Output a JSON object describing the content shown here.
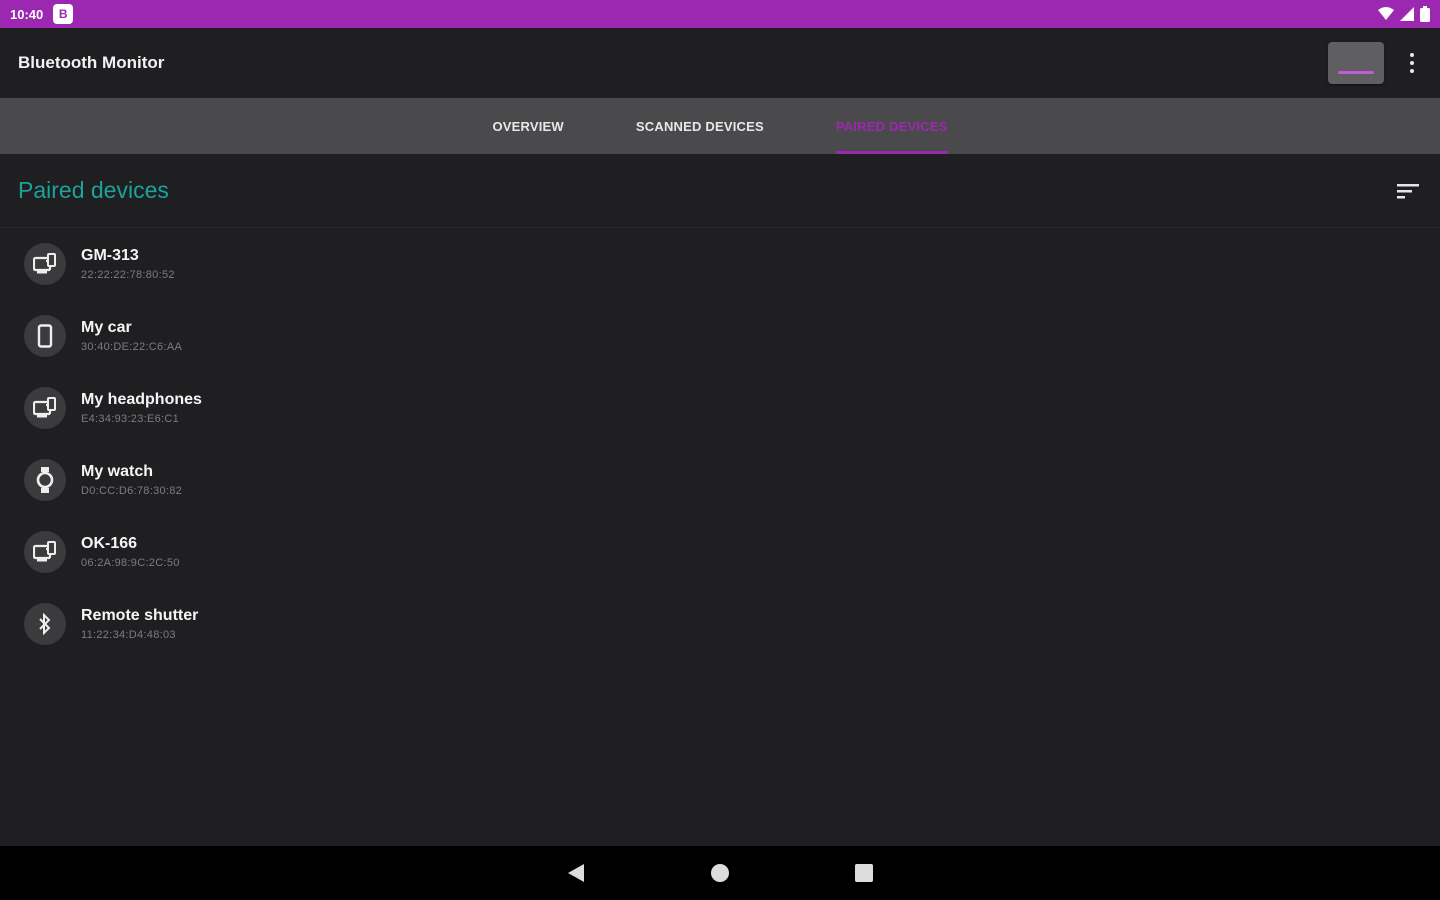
{
  "status_bar": {
    "time": "10:40",
    "notification_icon": "app-notification-icon",
    "notification_glyph": "B",
    "icons": [
      "wifi-icon",
      "cellular-signal-icon",
      "battery-icon"
    ]
  },
  "app_bar": {
    "title": "Bluetooth Monitor",
    "action_icon": "toggle-button-icon",
    "overflow_icon": "more-vert-icon"
  },
  "tabs": [
    {
      "label": "OVERVIEW",
      "active": false
    },
    {
      "label": "SCANNED DEVICES",
      "active": false
    },
    {
      "label": "PAIRED DEVICES",
      "active": true
    }
  ],
  "section": {
    "title": "Paired devices",
    "sort_icon": "sort-icon"
  },
  "devices": [
    {
      "name": "GM-313",
      "address": "22:22:22:78:80:52",
      "icon": "phonelink-icon"
    },
    {
      "name": "My car",
      "address": "30:40:DE:22:C6:AA",
      "icon": "phone-icon"
    },
    {
      "name": "My headphones",
      "address": "E4:34:93:23:E6:C1",
      "icon": "phonelink-icon"
    },
    {
      "name": "My watch",
      "address": "D0:CC:D6:78:30:82",
      "icon": "watch-icon"
    },
    {
      "name": "OK-166",
      "address": "06:2A:98:9C:2C:50",
      "icon": "phonelink-icon"
    },
    {
      "name": "Remote shutter",
      "address": "11:22:34:D4:48:03",
      "icon": "bluetooth-icon"
    }
  ],
  "nav_bar": {
    "icons": [
      "back-icon",
      "home-icon",
      "recents-icon"
    ]
  },
  "colors": {
    "accent": "#9c27b0",
    "section_title": "#1aa39a",
    "background": "#1f1f21",
    "tab_bar": "#4a4a4c"
  }
}
